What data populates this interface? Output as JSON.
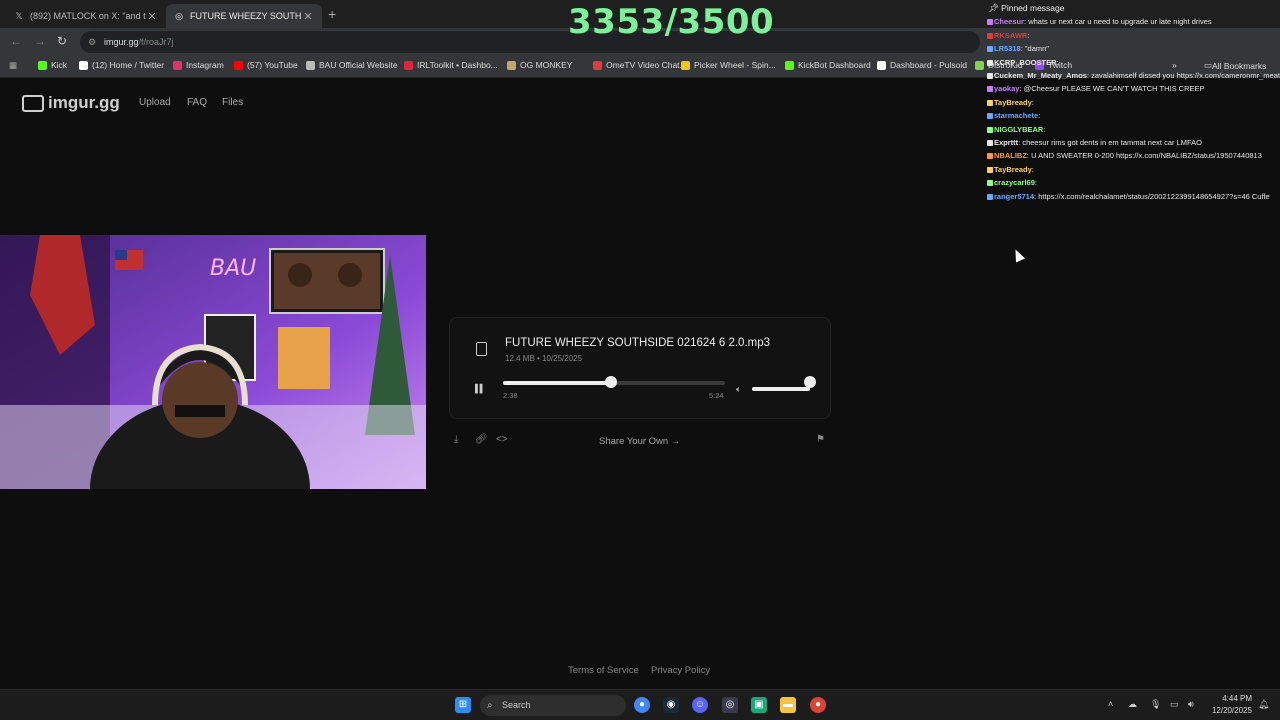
{
  "overlay": {
    "count": "3353/3500"
  },
  "browser": {
    "tabs": [
      {
        "title": "(892) MATLOCK on X: \"and that"
      },
      {
        "title": "FUTURE WHEEZY SOUTHSIDE"
      }
    ],
    "url_host": "imgur.gg",
    "url_path": "/f/roaJr7j",
    "bookmarks": [
      {
        "label": "Kick",
        "color": "#53fc18"
      },
      {
        "label": "(12) Home / Twitter",
        "color": "#ffffff"
      },
      {
        "label": "Instagram",
        "color": "#e1306c"
      },
      {
        "label": "(57) YouTube",
        "color": "#ff0000"
      },
      {
        "label": "BAU Official Website",
        "color": "#bbbbbb"
      },
      {
        "label": "IRLToolkit • Dashbo...",
        "color": "#e0223b"
      },
      {
        "label": "OG MONKEY",
        "color": "#c8a46a"
      },
      {
        "label": "OmeTV Video Chat...",
        "color": "#e23b3b"
      },
      {
        "label": "Picker Wheel - Spin...",
        "color": "#f5c518"
      },
      {
        "label": "KickBot Dashboard",
        "color": "#53fc18"
      },
      {
        "label": "Dashboard - Pulsoid",
        "color": "#ffffff"
      },
      {
        "label": "DistroKid",
        "color": "#7fd44e"
      },
      {
        "label": "Twitch",
        "color": "#9146ff"
      }
    ],
    "all_bookmarks": "All Bookmarks"
  },
  "site": {
    "logo": "imgur.gg",
    "nav": [
      "Upload",
      "FAQ",
      "Files"
    ],
    "footer": {
      "terms": "Terms of Service",
      "privacy": "Privacy Policy"
    }
  },
  "player": {
    "filename": "FUTURE WHEEZY SOUTHSIDE 021624 6 2.0.mp3",
    "meta": "12.4 MB • 10/25/2025",
    "current_time": "2:38",
    "duration": "5:24",
    "progress_fraction": 0.488,
    "volume_fraction": 1.0,
    "share_label": "Share Your Own →"
  },
  "chat": {
    "pinned_label": "Pinned message",
    "messages": [
      {
        "user": "Cheesur",
        "color": "#c77dff",
        "text": "whats ur next car u need to upgrade ur late night drives"
      },
      {
        "user": "RKSAWR",
        "color": "#e23b3b",
        "text": ""
      },
      {
        "user": "LR5318",
        "color": "#6aa9ff",
        "text": "\"damn\""
      },
      {
        "user": "KCRP_BOOSTER",
        "color": "#e8e8e8",
        "text": ""
      },
      {
        "user": "Cuckem_Mr_Meaty_Amos",
        "color": "#e8e8e8",
        "text": "zavalahimself dissed you https://x.com/cameronmr_meaty/status/2002491462030930083?s=61"
      },
      {
        "user": "yaokay",
        "color": "#c77dff",
        "text": "@Cheesur PLEASE WE CAN'T WATCH THIS CREEP"
      },
      {
        "user": "TayBready",
        "color": "#ffd35c",
        "text": ""
      },
      {
        "user": "starmachete",
        "color": "#6aa9ff",
        "text": ""
      },
      {
        "user": "NIGGLYBEAR",
        "color": "#8cff8c",
        "text": ""
      },
      {
        "user": "Exprttt",
        "color": "#e8e8e8",
        "text": "cheesur rims got dents in em tammat next car LMFAO"
      },
      {
        "user": "NBALIBZ",
        "color": "#ff9a3c",
        "text": "U AND SWEATER 0-200 https://x.com/NBALIBZ/status/19507440813"
      },
      {
        "user": "TayBready",
        "color": "#ffd35c",
        "text": ""
      },
      {
        "user": "crazycarl69",
        "color": "#8cff8c",
        "text": ""
      },
      {
        "user": "ranger5714",
        "color": "#6aa9ff",
        "text": "https://x.com/realchalamet/status/2002122399148654927?s=46 Cuffe"
      }
    ]
  },
  "taskbar": {
    "search_label": "Search",
    "time": "4:44 PM",
    "date": "12/20/2025"
  }
}
